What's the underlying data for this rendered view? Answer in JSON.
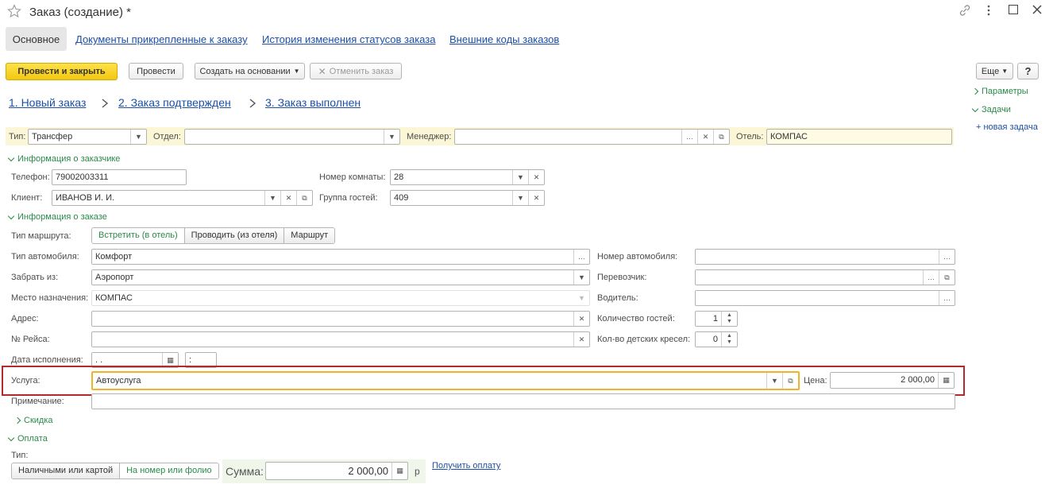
{
  "window": {
    "title": "Заказ (создание) *",
    "star_icon": "star-icon",
    "controls": [
      "link-icon",
      "more-icon",
      "maximize-icon",
      "close-icon"
    ]
  },
  "tabs": [
    {
      "label": "Основное",
      "active": true
    },
    {
      "label": "Документы прикрепленные к заказу"
    },
    {
      "label": "История изменения статусов заказа"
    },
    {
      "label": "Внешние коды заказов"
    }
  ],
  "toolbar": {
    "post_close": "Провести и закрыть",
    "post": "Провести",
    "create_based": "Создать на основании",
    "cancel_order": "Отменить заказ",
    "more": "Еще",
    "help": "?"
  },
  "statuses": [
    "1. Новый заказ",
    "2. Заказ подтвержден",
    "3. Заказ выполнен"
  ],
  "side_panel": {
    "params": "Параметры",
    "tasks": "Задачи",
    "new_task": "+ новая задача"
  },
  "header_row": {
    "type_label": "Тип:",
    "type_value": "Трансфер",
    "dept_label": "Отдел:",
    "dept_value": "",
    "manager_label": "Менеджер:",
    "manager_value": "",
    "hotel_label": "Отель:",
    "hotel_value": "КОМПАС"
  },
  "customer": {
    "section": "Информация о заказчике",
    "phone_label": "Телефон:",
    "phone_value": "79002003311",
    "client_label": "Клиент:",
    "client_value": "ИВАНОВ И. И.",
    "room_label": "Номер комнаты:",
    "room_value": "28",
    "group_label": "Группа гостей:",
    "group_value": "409"
  },
  "order": {
    "section": "Информация о заказе",
    "route_label": "Тип маршрута:",
    "route_options": [
      "Встретить (в отель)",
      "Проводить (из отеля)",
      "Маршрут"
    ],
    "car_type_label": "Тип автомобиля:",
    "car_type_value": "Комфорт",
    "pickup_label": "Забрать из:",
    "pickup_value": "Аэропорт",
    "dest_label": "Место назначения:",
    "dest_value": "КОМПАС",
    "address_label": "Адрес:",
    "address_value": "",
    "flight_label": "№ Рейса:",
    "flight_value": "",
    "date_label": "Дата исполнения:",
    "date_value": "  .  .",
    "time_value": "  :",
    "car_no_label": "Номер автомобиля:",
    "car_no_value": "",
    "carrier_label": "Перевозчик:",
    "carrier_value": "",
    "driver_label": "Водитель:",
    "driver_value": "",
    "guests_label": "Количество гостей:",
    "guests_value": "1",
    "child_seats_label": "Кол-во детских кресел:",
    "child_seats_value": "0",
    "service_label": "Услуга:",
    "service_value": "Автоуслуга",
    "price_label": "Цена:",
    "price_value": "2 000,00",
    "note_label": "Примечание:",
    "note_value": "",
    "discount": "Скидка"
  },
  "payment": {
    "section": "Оплата",
    "type_label": "Тип:",
    "options": [
      "Наличными или картой",
      "На номер или фолио"
    ],
    "sum_label": "Сумма:",
    "sum_value": "2 000,00",
    "currency": "р",
    "get_payment": "Получить оплату"
  },
  "colors": {
    "accent_green": "#2a8a4a",
    "primary_button": "#f7d31c",
    "highlight_border": "#b22a2a",
    "focus_border": "#f0b429",
    "link": "#1c4fa8"
  }
}
